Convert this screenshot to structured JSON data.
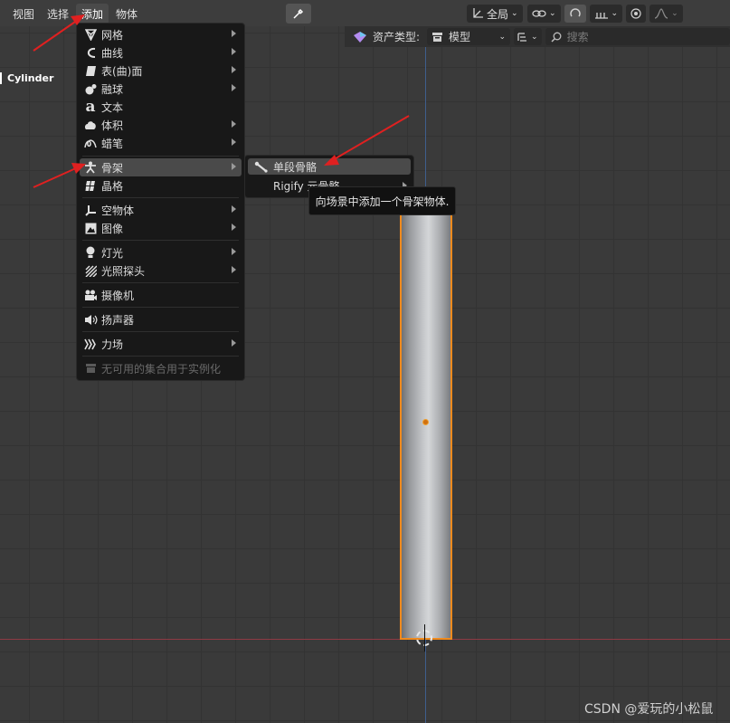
{
  "header": {
    "menus": [
      "视图",
      "选择",
      "添加",
      "物体"
    ],
    "active_menu": "添加",
    "transform_orientation": "全局",
    "asset_type_label": "资产类型:",
    "asset_type_value": "模型",
    "search_placeholder": "搜索"
  },
  "viewport": {
    "object_name": "Cylinder"
  },
  "add_menu": {
    "items": [
      {
        "label": "网格",
        "icon": "mesh-icon"
      },
      {
        "label": "曲线",
        "icon": "curve-icon"
      },
      {
        "label": "表(曲)面",
        "icon": "surface-icon"
      },
      {
        "label": "融球",
        "icon": "metaball-icon"
      },
      {
        "label": "文本",
        "icon": "text-icon"
      },
      {
        "label": "体积",
        "icon": "volume-icon"
      },
      {
        "label": "蜡笔",
        "icon": "grease-pencil-icon"
      },
      {
        "label": "骨架",
        "icon": "armature-icon"
      },
      {
        "label": "晶格",
        "icon": "lattice-icon"
      },
      {
        "label": "空物体",
        "icon": "empty-icon"
      },
      {
        "label": "图像",
        "icon": "image-icon"
      },
      {
        "label": "灯光",
        "icon": "light-icon"
      },
      {
        "label": "光照探头",
        "icon": "light-probe-icon"
      },
      {
        "label": "摄像机",
        "icon": "camera-icon"
      },
      {
        "label": "扬声器",
        "icon": "speaker-icon"
      },
      {
        "label": "力场",
        "icon": "force-field-icon"
      },
      {
        "label": "无可用的集合用于实例化",
        "icon": "collection-icon"
      }
    ]
  },
  "armature_submenu": {
    "items": [
      {
        "label": "单段骨骼",
        "icon": "bone-icon"
      },
      {
        "label": "Rigify 元骨骼"
      }
    ]
  },
  "tooltip": {
    "text": "向场景中添加一个骨架物体."
  },
  "watermark": "CSDN @爱玩的小松鼠",
  "colors": {
    "selection_outline": "#f08a1d",
    "annotation_arrow": "#e02020",
    "x_axis": "#8e3a44",
    "y_axis": "#3f5e8d"
  }
}
